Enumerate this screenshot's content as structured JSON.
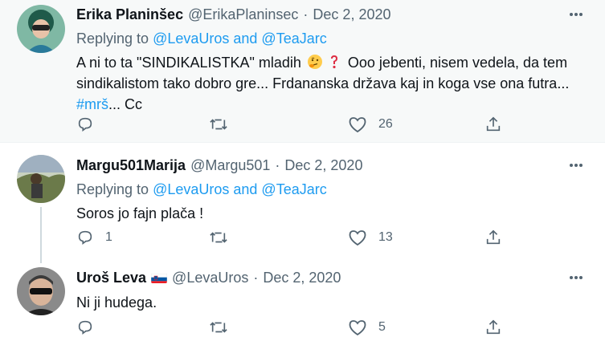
{
  "tweets": [
    {
      "name": "Erika Planinšec",
      "handle": "@ErikaPlaninsec",
      "separator": "·",
      "date": "Dec 2, 2020",
      "reply_prefix": "Replying to ",
      "reply_user1": "@LevaUros",
      "reply_and": " and ",
      "reply_user2": "@TeaJarc",
      "text_part1": "A ni to ta \"SINDIKALISTKA\" mladih ",
      "text_part2": " Ooo jebenti, nisem vedela, da tem sindikalistom tako dobro gre... Frdananska država kaj in koga vse ona futra... ",
      "hashtag": "#mrš",
      "text_part3": "... Cc",
      "emoji1": "thinking-face-emoji",
      "emoji2": "red-question-mark-emoji",
      "reply_count": "",
      "retweet_count": "",
      "like_count": "26"
    },
    {
      "name": "Margu501Marija",
      "handle": "@Margu501",
      "separator": "·",
      "date": "Dec 2, 2020",
      "reply_prefix": "Replying to ",
      "reply_user1": "@LevaUros",
      "reply_and": " and ",
      "reply_user2": "@TeaJarc",
      "text": "Soros jo fajn plača !",
      "reply_count": "1",
      "retweet_count": "",
      "like_count": "13"
    },
    {
      "name": "Uroš Leva",
      "flag": "slovenia-flag-icon",
      "handle": "@LevaUros",
      "separator": "·",
      "date": "Dec 2, 2020",
      "text": "Ni ji hudega.",
      "reply_count": "",
      "retweet_count": "",
      "like_count": "5"
    }
  ],
  "colors": {
    "link": "#1d9bf0",
    "secondary": "#536471",
    "highlight_bg": "#f7f9f9",
    "thread_line": "#cfd9de"
  },
  "icons": [
    "reply-icon",
    "retweet-icon",
    "like-icon",
    "share-icon",
    "more-icon"
  ]
}
